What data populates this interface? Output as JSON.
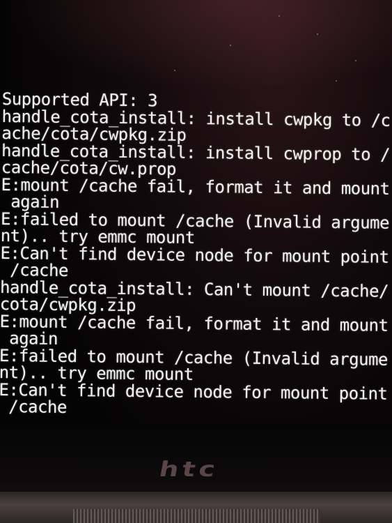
{
  "recovery_log": [
    "Supported API: 3",
    "handle_cota_install: install cwpkg to /c",
    "ache/cota/cwpkg.zip",
    "handle_cota_install: install cwprop to /",
    "cache/cota/cw.prop",
    "E:mount /cache fail, format it and mount",
    " again",
    "E:failed to mount /cache (Invalid argume",
    "nt).. try emmc mount",
    "E:Can't find device node for mount point",
    " /cache",
    "handle_cota_install: Can't mount /cache/",
    "cota/cwpkg.zip",
    "E:mount /cache fail, format it and mount",
    " again",
    "E:failed to mount /cache (Invalid argume",
    "nt).. try emmc mount",
    "E:Can't find device node for mount point",
    " /cache"
  ],
  "brand_logo": "htc",
  "colors": {
    "text": "#f2f2ee",
    "background": "#050405",
    "logo": "#5a4646"
  }
}
